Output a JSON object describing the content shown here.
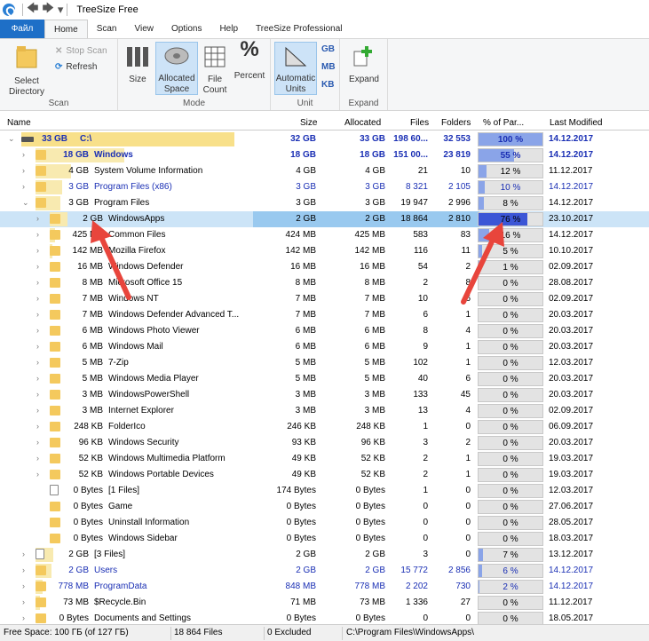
{
  "window": {
    "title": "TreeSize Free"
  },
  "tabs": [
    "Файл",
    "Home",
    "Scan",
    "View",
    "Options",
    "Help",
    "TreeSize Professional"
  ],
  "ribbon": {
    "scan": {
      "select_directory": "Select Directory",
      "stop_scan": "Stop Scan",
      "refresh": "Refresh",
      "label": "Scan"
    },
    "mode": {
      "size": "Size",
      "allocated_space": "Allocated Space",
      "file_count": "File Count",
      "percent": "Percent",
      "label": "Mode"
    },
    "unit": {
      "automatic_units": "Automatic Units",
      "gb": "GB",
      "mb": "MB",
      "kb": "KB",
      "label": "Unit"
    },
    "expand": {
      "expand": "Expand",
      "label": "Expand"
    }
  },
  "columns": {
    "name": "Name",
    "size": "Size",
    "allocated": "Allocated",
    "files": "Files",
    "folders": "Folders",
    "percent": "% of Par...",
    "modified": "Last Modified"
  },
  "rows": [
    {
      "lvl": 0,
      "exp": "v",
      "icon": "drive",
      "bar": 240,
      "sz": "33 GB",
      "name": "C:\\",
      "size": "32 GB",
      "alloc": "33 GB",
      "files": "198 60...",
      "folders": "32 553",
      "pct": "100 %",
      "pv": 100,
      "mod": "14.12.2017",
      "bold": true,
      "blue": true
    },
    {
      "lvl": 1,
      "exp": ">",
      "icon": "folder",
      "bar": 100,
      "sz": "18 GB",
      "name": "Windows",
      "size": "18 GB",
      "alloc": "18 GB",
      "files": "151 00...",
      "folders": "23 819",
      "pct": "55 %",
      "pv": 55,
      "mod": "14.12.2017",
      "bold": true,
      "blue": true
    },
    {
      "lvl": 1,
      "exp": ">",
      "icon": "folder",
      "bar": 40,
      "sz": "4 GB",
      "name": "System Volume Information",
      "size": "4 GB",
      "alloc": "4 GB",
      "files": "21",
      "folders": "10",
      "pct": "12 %",
      "pv": 12,
      "mod": "11.12.2017"
    },
    {
      "lvl": 1,
      "exp": ">",
      "icon": "folder",
      "bar": 30,
      "sz": "3 GB",
      "name": "Program Files (x86)",
      "size": "3 GB",
      "alloc": "3 GB",
      "files": "8 321",
      "folders": "2 105",
      "pct": "10 %",
      "pv": 10,
      "mod": "14.12.2017",
      "blue": true
    },
    {
      "lvl": 1,
      "exp": "v",
      "icon": "folder",
      "bar": 28,
      "sz": "3 GB",
      "name": "Program Files",
      "size": "3 GB",
      "alloc": "3 GB",
      "files": "19 947",
      "folders": "2 996",
      "pct": "8 %",
      "pv": 8,
      "mod": "14.12.2017"
    },
    {
      "lvl": 2,
      "exp": ">",
      "icon": "folder",
      "bar": 20,
      "sz": "2 GB",
      "name": "WindowsApps",
      "size": "2 GB",
      "alloc": "2 GB",
      "files": "18 864",
      "folders": "2 810",
      "pct": "76 %",
      "pv": 76,
      "mod": "23.10.2017",
      "sel": true
    },
    {
      "lvl": 2,
      "exp": ">",
      "icon": "folder",
      "bar": 6,
      "sz": "425 MB",
      "name": "Common Files",
      "size": "424 MB",
      "alloc": "425 MB",
      "files": "583",
      "folders": "83",
      "pct": "16 %",
      "pv": 16,
      "mod": "14.12.2017"
    },
    {
      "lvl": 2,
      "exp": ">",
      "icon": "folder",
      "bar": 3,
      "sz": "142 MB",
      "name": "Mozilla Firefox",
      "size": "142 MB",
      "alloc": "142 MB",
      "files": "116",
      "folders": "11",
      "pct": "5 %",
      "pv": 5,
      "mod": "10.10.2017"
    },
    {
      "lvl": 2,
      "exp": ">",
      "icon": "folder",
      "bar": 0,
      "sz": "16 MB",
      "name": "Windows Defender",
      "size": "16 MB",
      "alloc": "16 MB",
      "files": "54",
      "folders": "2",
      "pct": "1 %",
      "pv": 1,
      "mod": "02.09.2017"
    },
    {
      "lvl": 2,
      "exp": ">",
      "icon": "folder",
      "bar": 0,
      "sz": "8 MB",
      "name": "Microsoft Office 15",
      "size": "8 MB",
      "alloc": "8 MB",
      "files": "2",
      "folders": "8",
      "pct": "0 %",
      "pv": 0,
      "mod": "28.08.2017"
    },
    {
      "lvl": 2,
      "exp": ">",
      "icon": "folder",
      "bar": 0,
      "sz": "7 MB",
      "name": "Windows NT",
      "size": "7 MB",
      "alloc": "7 MB",
      "files": "10",
      "folders": "6",
      "pct": "0 %",
      "pv": 0,
      "mod": "02.09.2017"
    },
    {
      "lvl": 2,
      "exp": ">",
      "icon": "folder",
      "bar": 0,
      "sz": "7 MB",
      "name": "Windows Defender Advanced T...",
      "size": "7 MB",
      "alloc": "7 MB",
      "files": "6",
      "folders": "1",
      "pct": "0 %",
      "pv": 0,
      "mod": "20.03.2017"
    },
    {
      "lvl": 2,
      "exp": ">",
      "icon": "folder",
      "bar": 0,
      "sz": "6 MB",
      "name": "Windows Photo Viewer",
      "size": "6 MB",
      "alloc": "6 MB",
      "files": "8",
      "folders": "4",
      "pct": "0 %",
      "pv": 0,
      "mod": "20.03.2017"
    },
    {
      "lvl": 2,
      "exp": ">",
      "icon": "folder",
      "bar": 0,
      "sz": "6 MB",
      "name": "Windows Mail",
      "size": "6 MB",
      "alloc": "6 MB",
      "files": "9",
      "folders": "1",
      "pct": "0 %",
      "pv": 0,
      "mod": "20.03.2017"
    },
    {
      "lvl": 2,
      "exp": ">",
      "icon": "folder",
      "bar": 0,
      "sz": "5 MB",
      "name": "7-Zip",
      "size": "5 MB",
      "alloc": "5 MB",
      "files": "102",
      "folders": "1",
      "pct": "0 %",
      "pv": 0,
      "mod": "12.03.2017"
    },
    {
      "lvl": 2,
      "exp": ">",
      "icon": "folder",
      "bar": 0,
      "sz": "5 MB",
      "name": "Windows Media Player",
      "size": "5 MB",
      "alloc": "5 MB",
      "files": "40",
      "folders": "6",
      "pct": "0 %",
      "pv": 0,
      "mod": "20.03.2017"
    },
    {
      "lvl": 2,
      "exp": ">",
      "icon": "folder",
      "bar": 0,
      "sz": "3 MB",
      "name": "WindowsPowerShell",
      "size": "3 MB",
      "alloc": "3 MB",
      "files": "133",
      "folders": "45",
      "pct": "0 %",
      "pv": 0,
      "mod": "20.03.2017"
    },
    {
      "lvl": 2,
      "exp": ">",
      "icon": "folder",
      "bar": 0,
      "sz": "3 MB",
      "name": "Internet Explorer",
      "size": "3 MB",
      "alloc": "3 MB",
      "files": "13",
      "folders": "4",
      "pct": "0 %",
      "pv": 0,
      "mod": "02.09.2017"
    },
    {
      "lvl": 2,
      "exp": ">",
      "icon": "folder",
      "bar": 0,
      "sz": "248 KB",
      "name": "FolderIco",
      "size": "246 KB",
      "alloc": "248 KB",
      "files": "1",
      "folders": "0",
      "pct": "0 %",
      "pv": 0,
      "mod": "06.09.2017"
    },
    {
      "lvl": 2,
      "exp": ">",
      "icon": "folder",
      "bar": 0,
      "sz": "96 KB",
      "name": "Windows Security",
      "size": "93 KB",
      "alloc": "96 KB",
      "files": "3",
      "folders": "2",
      "pct": "0 %",
      "pv": 0,
      "mod": "20.03.2017"
    },
    {
      "lvl": 2,
      "exp": ">",
      "icon": "folder",
      "bar": 0,
      "sz": "52 KB",
      "name": "Windows Multimedia Platform",
      "size": "49 KB",
      "alloc": "52 KB",
      "files": "2",
      "folders": "1",
      "pct": "0 %",
      "pv": 0,
      "mod": "19.03.2017"
    },
    {
      "lvl": 2,
      "exp": ">",
      "icon": "folder",
      "bar": 0,
      "sz": "52 KB",
      "name": "Windows Portable Devices",
      "size": "49 KB",
      "alloc": "52 KB",
      "files": "2",
      "folders": "1",
      "pct": "0 %",
      "pv": 0,
      "mod": "19.03.2017"
    },
    {
      "lvl": 2,
      "exp": "",
      "icon": "file",
      "bar": 0,
      "sz": "0 Bytes",
      "name": "[1 Files]",
      "size": "174 Bytes",
      "alloc": "0 Bytes",
      "files": "1",
      "folders": "0",
      "pct": "0 %",
      "pv": 0,
      "mod": "12.03.2017"
    },
    {
      "lvl": 2,
      "exp": "",
      "icon": "folder",
      "bar": 0,
      "sz": "0 Bytes",
      "name": "Game",
      "size": "0 Bytes",
      "alloc": "0 Bytes",
      "files": "0",
      "folders": "0",
      "pct": "0 %",
      "pv": 0,
      "mod": "27.06.2017"
    },
    {
      "lvl": 2,
      "exp": "",
      "icon": "folder",
      "bar": 0,
      "sz": "0 Bytes",
      "name": "Uninstall Information",
      "size": "0 Bytes",
      "alloc": "0 Bytes",
      "files": "0",
      "folders": "0",
      "pct": "0 %",
      "pv": 0,
      "mod": "28.05.2017"
    },
    {
      "lvl": 2,
      "exp": "",
      "icon": "folder",
      "bar": 0,
      "sz": "0 Bytes",
      "name": "Windows Sidebar",
      "size": "0 Bytes",
      "alloc": "0 Bytes",
      "files": "0",
      "folders": "0",
      "pct": "0 %",
      "pv": 0,
      "mod": "18.03.2017"
    },
    {
      "lvl": 1,
      "exp": ">",
      "icon": "file",
      "bar": 20,
      "sz": "2 GB",
      "name": "[3 Files]",
      "size": "2 GB",
      "alloc": "2 GB",
      "files": "3",
      "folders": "0",
      "pct": "7 %",
      "pv": 7,
      "mod": "13.12.2017"
    },
    {
      "lvl": 1,
      "exp": ">",
      "icon": "folder",
      "bar": 18,
      "sz": "2 GB",
      "name": "Users",
      "size": "2 GB",
      "alloc": "2 GB",
      "files": "15 772",
      "folders": "2 856",
      "pct": "6 %",
      "pv": 6,
      "mod": "14.12.2017",
      "blue": true
    },
    {
      "lvl": 1,
      "exp": ">",
      "icon": "folder",
      "bar": 8,
      "sz": "778 MB",
      "name": "ProgramData",
      "size": "848 MB",
      "alloc": "778 MB",
      "files": "2 202",
      "folders": "730",
      "pct": "2 %",
      "pv": 2,
      "mod": "14.12.2017",
      "blue": true
    },
    {
      "lvl": 1,
      "exp": ">",
      "icon": "folder",
      "bar": 5,
      "sz": "73 MB",
      "name": "$Recycle.Bin",
      "size": "71 MB",
      "alloc": "73 MB",
      "files": "1 336",
      "folders": "27",
      "pct": "0 %",
      "pv": 0,
      "mod": "11.12.2017"
    },
    {
      "lvl": 1,
      "exp": ">",
      "icon": "folder",
      "bar": 0,
      "sz": "0 Bytes",
      "name": "Documents and Settings",
      "size": "0 Bytes",
      "alloc": "0 Bytes",
      "files": "0",
      "folders": "0",
      "pct": "0 %",
      "pv": 0,
      "mod": "18.05.2017"
    }
  ],
  "status": {
    "free": "Free Space: 100 ГБ  (of 127 ГБ)",
    "files": "18 864  Files",
    "excluded": "0 Excluded",
    "path": "C:\\Program Files\\WindowsApps\\"
  },
  "colors": {
    "accent": "#1e6fc7",
    "bar": "#f8eab0",
    "arrow": "#e8453c"
  }
}
